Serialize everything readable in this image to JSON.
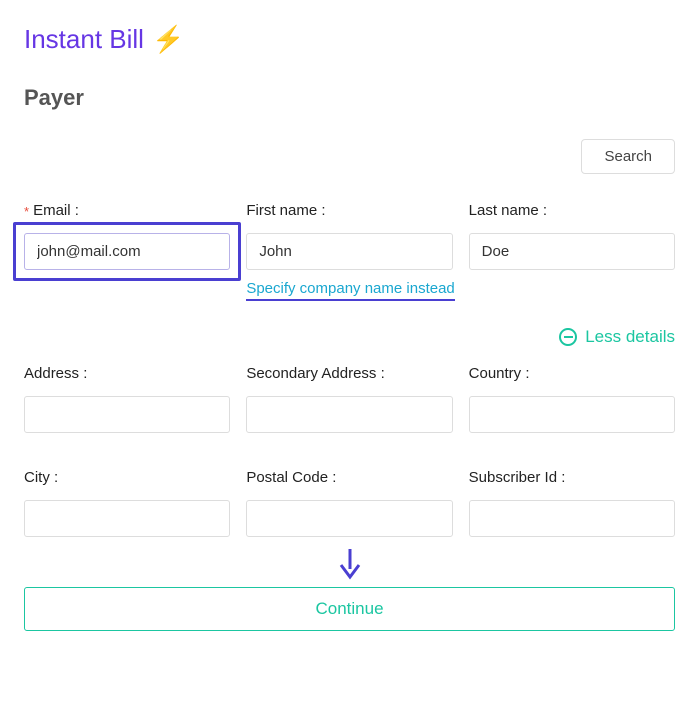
{
  "header": {
    "title": "Instant Bill",
    "icon_emoji": "⚡"
  },
  "section": {
    "title": "Payer"
  },
  "search": {
    "label": "Search"
  },
  "fields": {
    "email": {
      "label": "Email :",
      "value": "john@mail.com",
      "required": true
    },
    "first_name": {
      "label": "First name :",
      "value": "John"
    },
    "last_name": {
      "label": "Last name :",
      "value": "Doe"
    },
    "address": {
      "label": "Address :",
      "value": ""
    },
    "secondary_address": {
      "label": "Secondary Address :",
      "value": ""
    },
    "country": {
      "label": "Country :",
      "value": ""
    },
    "city": {
      "label": "City :",
      "value": ""
    },
    "postal_code": {
      "label": "Postal Code :",
      "value": ""
    },
    "subscriber_id": {
      "label": "Subscriber Id :",
      "value": ""
    }
  },
  "links": {
    "company_toggle": "Specify company name instead",
    "less_details": "Less details"
  },
  "actions": {
    "continue": "Continue"
  },
  "annotation": {
    "highlight_color": "#4a3fd1",
    "accent_color": "#1bc6a1",
    "link_color": "#1aa7d0",
    "title_color": "#6636e4"
  }
}
